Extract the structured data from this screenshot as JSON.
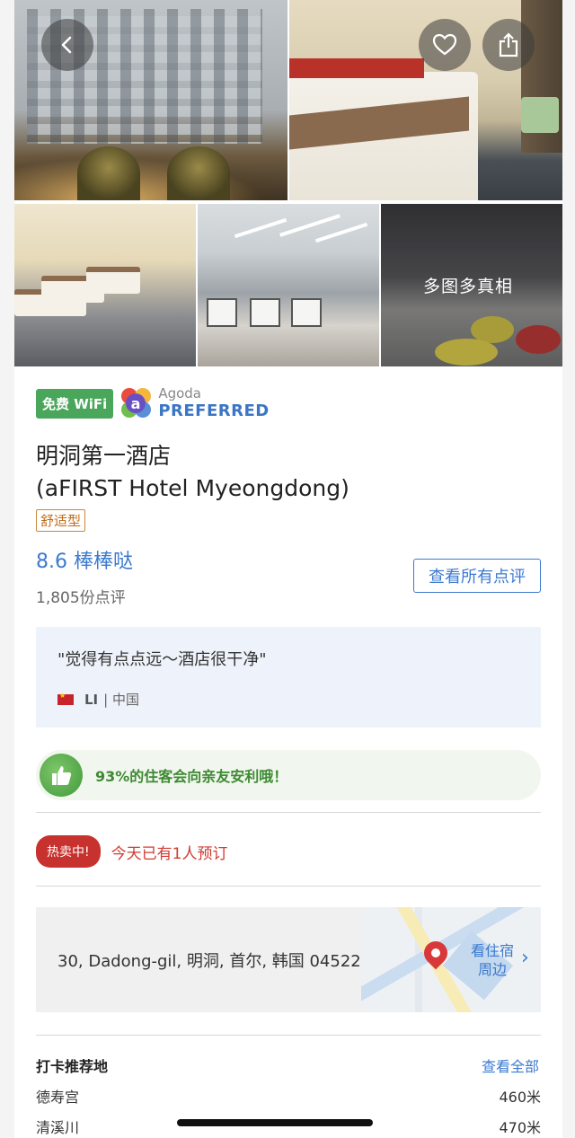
{
  "photos": {
    "more_label": "多图多真相"
  },
  "badges": {
    "wifi": "免费 WiFi",
    "agoda_top": "Agoda",
    "agoda_bottom": "PREFERRED"
  },
  "hotel": {
    "name_cn": "明洞第一酒店",
    "name_en": "(aFIRST Hotel Myeongdong)",
    "category": "舒适型",
    "rating": "8.6 棒棒哒",
    "review_count": "1,805份点评",
    "see_reviews": "查看所有点评"
  },
  "review": {
    "quote": "\"觉得有点点远～酒店很干净\"",
    "author": "LI",
    "country": "| 中国"
  },
  "recommend": {
    "text": "93%的住客会向亲友安利哦！"
  },
  "hot": {
    "badge": "热卖中!",
    "text": "今天已有1人预订"
  },
  "address": {
    "text": "30, Dadong-gil, 明洞, 首尔, 韩国 04522",
    "nearby_line1": "看住宿",
    "nearby_line2": "周边"
  },
  "checkin": {
    "title": "打卡推荐地",
    "see_all": "查看全部",
    "places": [
      {
        "name": "德寿宫",
        "distance": "460米"
      },
      {
        "name": "清溪川",
        "distance": "470米"
      }
    ]
  },
  "colors": {
    "accent_blue": "#3b7ad0",
    "wifi_green": "#4aa65a",
    "hot_red": "#c8322e",
    "tag_orange": "#c06b1a"
  },
  "icons": [
    "back-icon",
    "heart-icon",
    "share-icon",
    "agoda-logo-icon",
    "thumbs-up-icon",
    "map-pin-icon",
    "chevron-right-icon",
    "china-flag-icon"
  ]
}
